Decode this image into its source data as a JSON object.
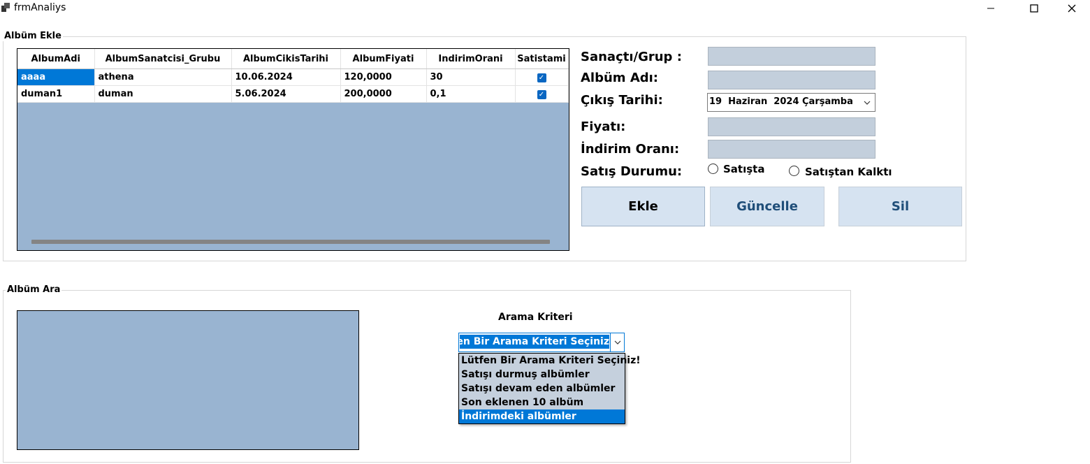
{
  "window": {
    "title": "frmAnaliys",
    "minimize": "—",
    "maximize": "☐",
    "close": "✕"
  },
  "groups": {
    "add": "Albüm Ekle",
    "search": "Albüm Ara"
  },
  "grid": {
    "columns": [
      "AlbumAdi",
      "AlbumSanatcisi_Grubu",
      "AlbumCikisTarihi",
      "AlbumFiyati",
      "IndirimOrani",
      "Satistami"
    ],
    "rows": [
      {
        "AlbumAdi": "aaaa",
        "AlbumSanatcisi_Grubu": "athena",
        "AlbumCikisTarihi": "10.06.2024",
        "AlbumFiyati": "120,0000",
        "IndirimOrani": "30",
        "Satistami": true
      },
      {
        "AlbumAdi": "duman1",
        "AlbumSanatcisi_Grubu": "duman",
        "AlbumCikisTarihi": "5.06.2024",
        "AlbumFiyati": "200,0000",
        "IndirimOrani": "0,1",
        "Satistami": true
      }
    ]
  },
  "form": {
    "artist_label": "Sanaçtı/Grup :",
    "album_label": "Albüm Adı:",
    "date_label": "Çıkış Tarihi:",
    "date_value": "19  Haziran  2024 Çarşamba",
    "price_label": "Fiyatı:",
    "discount_label": "İndirim Oranı:",
    "status_label": "Satış Durumu:",
    "radio_on_sale": "Satışta",
    "radio_off_sale": "Satıştan Kalktı",
    "artist_value": "",
    "album_value": "",
    "price_value": "",
    "discount_value": ""
  },
  "buttons": {
    "add": "Ekle",
    "update": "Güncelle",
    "delete": "Sil"
  },
  "colors": {
    "update_text": "#1f4e79",
    "delete_text": "#1f4e79"
  },
  "search": {
    "criteria_label": "Arama Kriteri",
    "selected": "Lütfen Bir Arama Kriteri Seçiniz!",
    "options": [
      "Lütfen Bir Arama Kriteri Seçiniz!",
      "Satışı durmuş albümler",
      "Satışı devam eden albümler",
      "Son eklenen 10 albüm",
      "İndirimdeki albümler"
    ],
    "highlighted_option": "İndirimdeki albümler"
  }
}
